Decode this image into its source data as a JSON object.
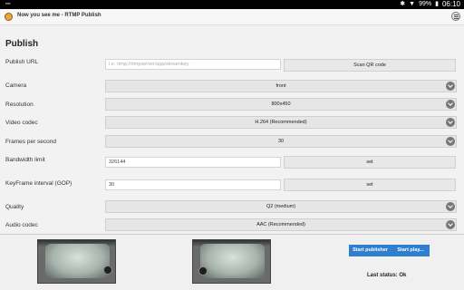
{
  "statusbar": {
    "usb_icon": "usb-icon",
    "battery": "99%",
    "time": "06:10",
    "icons": [
      "bluetooth-icon",
      "wifi-icon",
      "battery-icon"
    ]
  },
  "appbar": {
    "title": "Now you see me - RTMP Publish",
    "logo_icon": "app-logo-icon",
    "menu_icon": "overflow-menu-icon"
  },
  "heading": "Publish",
  "publish_url": {
    "label": "Publish URL",
    "placeholder": "i.e. rtmp://rtmpserver/app/streamkey",
    "button": "Scan QR code"
  },
  "camera": {
    "label": "Camera",
    "value": "front"
  },
  "resolution": {
    "label": "Resolution",
    "value": "800x450"
  },
  "video_codec": {
    "label": "Video codec",
    "value": "H.264 (Recommended)"
  },
  "fps": {
    "label": "Frames per second",
    "value": "30"
  },
  "bandwidth": {
    "label": "Bandwidth limit",
    "value": "326144",
    "button": "set"
  },
  "keyframe": {
    "label": "KeyFrame interval (GOP)",
    "value": "30",
    "button": "set"
  },
  "quality": {
    "label": "Quality",
    "value": "Q2 (medium)"
  },
  "audio_codec": {
    "label": "Audio codec",
    "value": "AAC (Recommended)"
  },
  "actions": {
    "start_publisher": "Start publisher",
    "start_play": "Start play..."
  },
  "last_status": "Last status: Ok"
}
